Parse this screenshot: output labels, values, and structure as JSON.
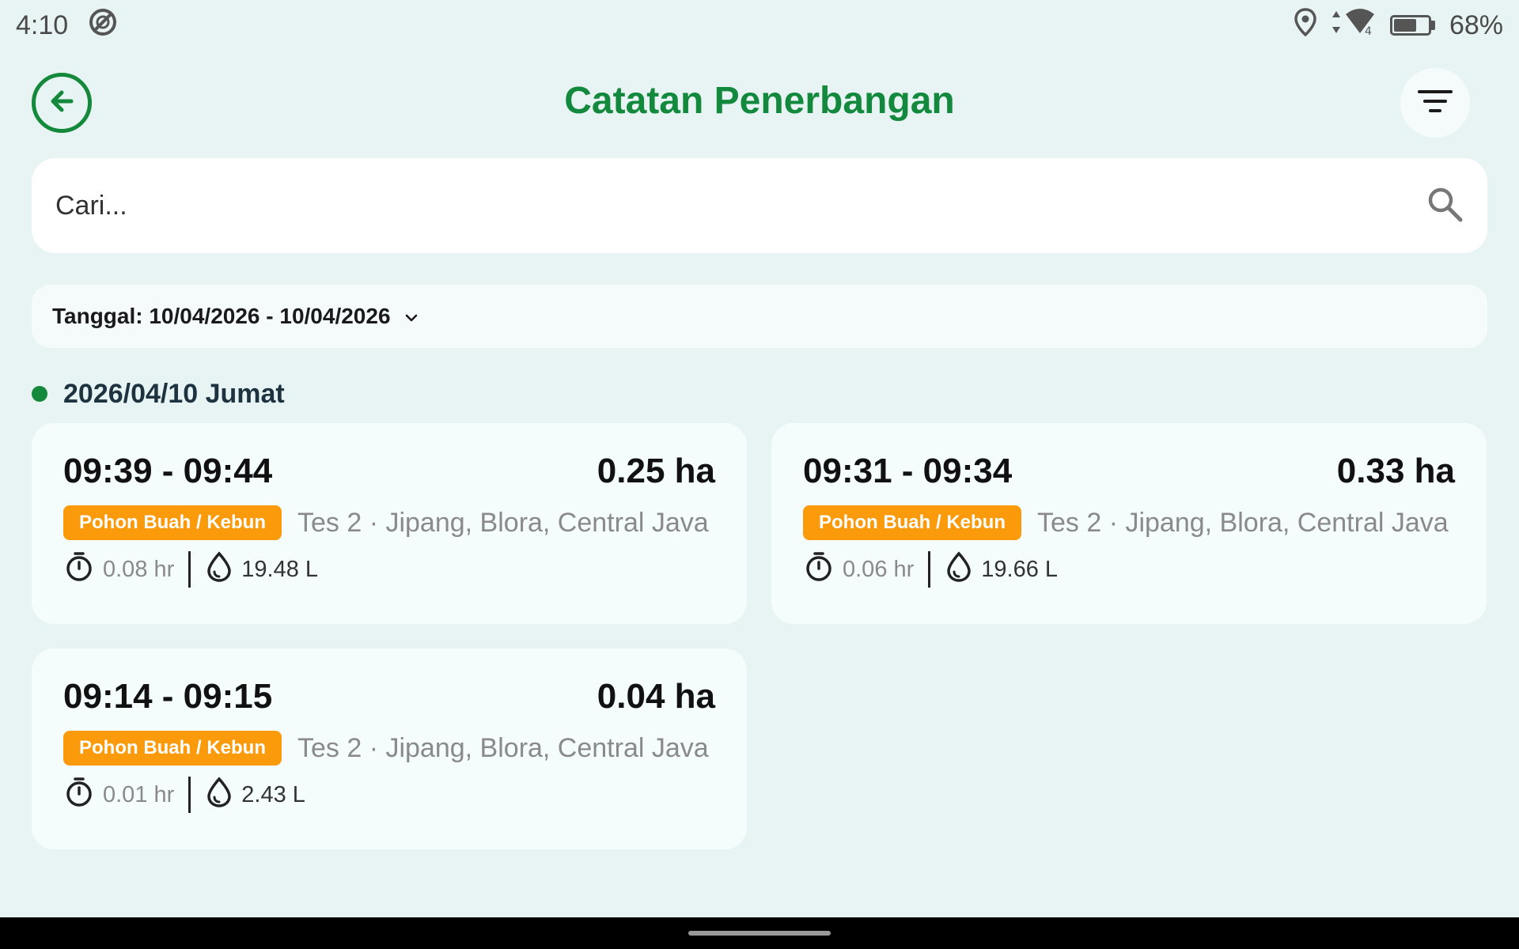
{
  "status_bar": {
    "time": "4:10",
    "battery_percent": "68%",
    "battery_level": 0.68,
    "icons": [
      "sync-icon",
      "location-icon",
      "signal-icon",
      "battery-icon"
    ]
  },
  "header": {
    "title": "Catatan Penerbangan",
    "back_icon": "arrow-left-icon",
    "filter_icon": "filter-icon"
  },
  "search": {
    "placeholder": "Cari...",
    "value": ""
  },
  "date_filter": {
    "label": "Tanggal: 10/04/2026 - 10/04/2026"
  },
  "groups": [
    {
      "date": "2026/04/10 Jumat",
      "records": [
        {
          "time_range": "09:39 - 09:44",
          "area": "0.25 ha",
          "tag": "Pohon Buah / Kebun",
          "location": "Tes 2 · Jipang, Blora, Central Java",
          "duration": "0.08 hr",
          "volume": "19.48 L"
        },
        {
          "time_range": "09:31 - 09:34",
          "area": "0.33 ha",
          "tag": "Pohon Buah / Kebun",
          "location": "Tes 2 · Jipang, Blora, Central Java",
          "duration": "0.06 hr",
          "volume": "19.66 L"
        },
        {
          "time_range": "09:14 - 09:15",
          "area": "0.04 ha",
          "tag": "Pohon Buah / Kebun",
          "location": "Tes 2 · Jipang, Blora, Central Java",
          "duration": "0.01 hr",
          "volume": "2.43 L"
        }
      ]
    }
  ],
  "colors": {
    "background": "#e8f4f3",
    "primary_green": "#12893c",
    "tag_orange": "#fb9a0a",
    "card_bg": "#f4fcfc"
  }
}
